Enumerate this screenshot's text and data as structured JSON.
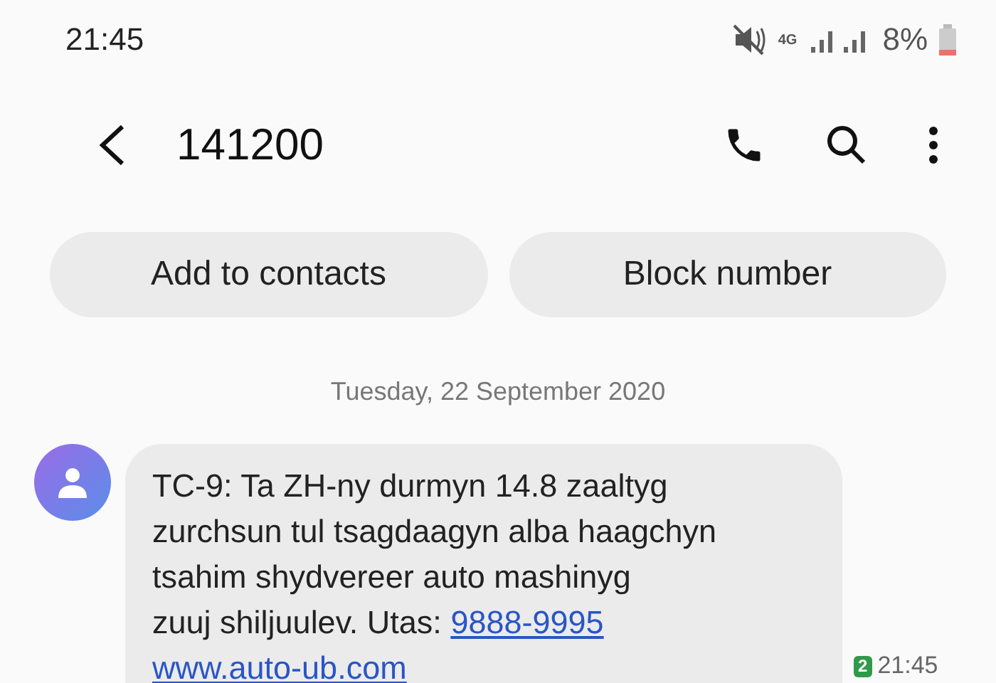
{
  "status_bar": {
    "time": "21:45",
    "network": "4G",
    "battery": "8%"
  },
  "header": {
    "title": "141200"
  },
  "actions": [
    "Add to contacts",
    "Block number"
  ],
  "date_divider": "Tuesday, 22 September 2020",
  "message": {
    "lines": [
      "TC-9: Ta ZH-ny durmyn 14.8 zaaltyg",
      "zurchsun tul tsagdaagyn alba haagchyn",
      "tsahim shydvereer auto mashinyg",
      "zuuj shiljuulev. Utas: "
    ],
    "phone_link": "9888-9995",
    "url_link": "www.auto-ub.com",
    "sim": "2",
    "time": "21:45"
  }
}
